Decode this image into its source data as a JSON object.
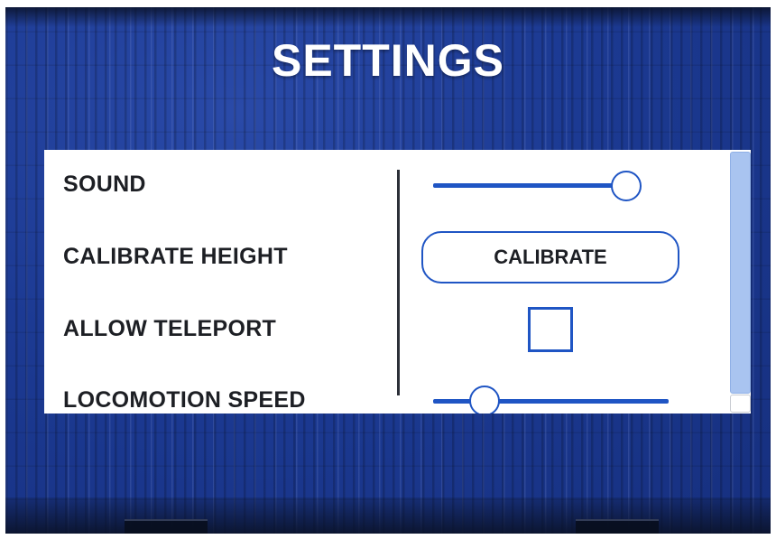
{
  "header": {
    "title": "SETTINGS"
  },
  "settings": {
    "sound": {
      "label": "SOUND",
      "value_fraction": 0.93
    },
    "calibrate_height": {
      "label": "CALIBRATE HEIGHT",
      "button_label": "CALIBRATE"
    },
    "allow_teleport": {
      "label": "ALLOW TELEPORT",
      "checked": false
    },
    "locomotion_speed": {
      "label": "LOCOMOTION SPEED",
      "value_fraction": 0.22
    }
  },
  "scroll": {
    "position_fraction": 0.0
  },
  "colors": {
    "accent": "#1f55c4",
    "background": "#1c3a93",
    "panel": "#ffffff",
    "text": "#1d1f24"
  },
  "icons": {
    "checkbox": "checkbox-empty-icon",
    "slider_thumb": "circle-knob-icon"
  }
}
